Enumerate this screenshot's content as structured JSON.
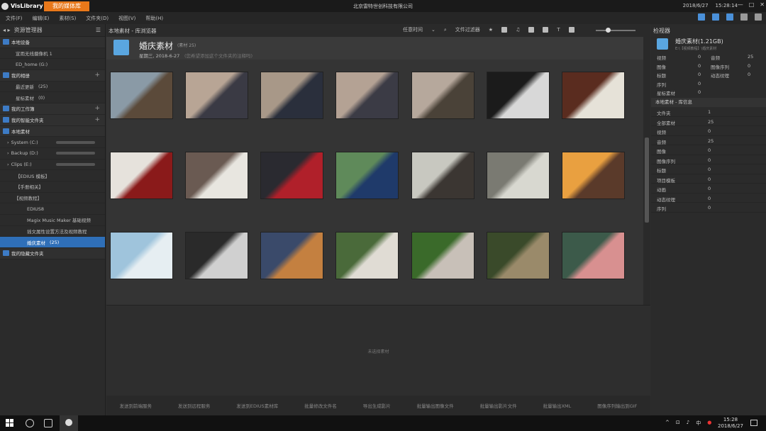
{
  "app": {
    "name": "VisLibrary",
    "active_tab": "我的媒体库",
    "company": "北京雷特世创科技有限公司",
    "date": "2018/6/27",
    "time": "15:28:14"
  },
  "menu": [
    "文件(F)",
    "编辑(E)",
    "素材(S)",
    "文件夹(D)",
    "视图(V)",
    "帮助(H)"
  ],
  "left_panel": {
    "title": "资源管理器",
    "items": [
      {
        "label": "本地设备",
        "type": "section"
      },
      {
        "label": "宣雨无线摄像机 1",
        "type": "item"
      },
      {
        "label": "ED_home (G:)",
        "type": "item"
      },
      {
        "label": "我的相册",
        "type": "section"
      },
      {
        "label": "最近更新",
        "count": "(25)",
        "type": "item"
      },
      {
        "label": "星标素材",
        "count": "(0)",
        "type": "item"
      },
      {
        "label": "我的工作簿",
        "type": "section"
      },
      {
        "label": "我的智能文件夹",
        "type": "section"
      },
      {
        "label": "本地素材",
        "type": "section"
      },
      {
        "label": "System (C:)",
        "type": "drive"
      },
      {
        "label": "Backup (D:)",
        "type": "drive"
      },
      {
        "label": "Clips (E:)",
        "type": "drive"
      },
      {
        "label": "【EDIUS 模板】",
        "type": "folder"
      },
      {
        "label": "【手册相关】",
        "type": "folder"
      },
      {
        "label": "【视频教程】",
        "type": "folder"
      },
      {
        "label": "EDIUS8",
        "type": "folder"
      },
      {
        "label": "Magix Music Maker 基础视频",
        "type": "folder"
      },
      {
        "label": "插文属性设置方法及视频教程",
        "type": "folder"
      },
      {
        "label": "婚庆素材",
        "count": "(25)",
        "type": "selected"
      },
      {
        "label": "我的隐藏文件夹",
        "type": "section"
      }
    ]
  },
  "center": {
    "breadcrumb": "本地素材 - 库浏览器",
    "sort": "任意时间",
    "filter_label": "文件过滤器",
    "album_title": "婚庆素材",
    "album_count": "(素材 25)",
    "album_date": "星期三, 2018-6-27",
    "album_hint": "(您希望添加这个文件夹的注释吗)",
    "preview_label": "未选择素材",
    "actions": [
      "发送到前端服务",
      "发送到远程服务",
      "发送到EDIUS素材库",
      "批量修改文件名",
      "导出生成影片",
      "批量输出图像文件",
      "批量输出影片文件",
      "批量输出XML",
      "图像序列输出到GIF"
    ]
  },
  "thumbs": [
    {
      "c1": "#8a9aa6",
      "c2": "#5b4a3a"
    },
    {
      "c1": "#b8a595",
      "c2": "#3a3a44"
    },
    {
      "c1": "#a89888",
      "c2": "#2a2f3c"
    },
    {
      "c1": "#b4a294",
      "c2": "#3b3b45"
    },
    {
      "c1": "#b6a89c",
      "c2": "#4a4238"
    },
    {
      "c1": "#1b1b1b",
      "c2": "#d8d8d8"
    },
    {
      "c1": "#5a2c1f",
      "c2": "#e6e2d8"
    },
    {
      "c1": "#e6e2dc",
      "c2": "#8a1a1a"
    },
    {
      "c1": "#6a5a52",
      "c2": "#e8e6e0"
    },
    {
      "c1": "#2a2a30",
      "c2": "#b0202a"
    },
    {
      "c1": "#5f8a5a",
      "c2": "#1f3a6a"
    },
    {
      "c1": "#c8c8c0",
      "c2": "#3b3632"
    },
    {
      "c1": "#7a7a72",
      "c2": "#d8d8d0"
    },
    {
      "c1": "#e9a040",
      "c2": "#5a3a2a"
    },
    {
      "c1": "#9fc4dc",
      "c2": "#e6eef2"
    },
    {
      "c1": "#2a2a2a",
      "c2": "#d0d0d0"
    },
    {
      "c1": "#3a4a6a",
      "c2": "#c48040"
    },
    {
      "c1": "#4a6a3a",
      "c2": "#e0dcd4"
    },
    {
      "c1": "#3a6a2a",
      "c2": "#c8c0b8"
    },
    {
      "c1": "#3a4a2a",
      "c2": "#9a8a6a"
    },
    {
      "c1": "#3c5a4a",
      "c2": "#d89090"
    }
  ],
  "right_panel": {
    "title": "检视器",
    "folder_name": "婚庆素材(1.21GB)",
    "folder_path": "E:\\【视频教程】\\婚庆素材",
    "stats_left": [
      [
        "视频",
        "0"
      ],
      [
        "图像",
        "0"
      ],
      [
        "标题",
        "0"
      ],
      [
        "序列",
        "0"
      ],
      [
        "星标素材",
        "0"
      ]
    ],
    "stats_right": [
      [
        "音频",
        "25"
      ],
      [
        "图像序列",
        "0"
      ],
      [
        "动态纹理",
        "0"
      ]
    ],
    "lib_title": "本地素材 - 库信息",
    "lib": [
      [
        "文件夹",
        "1"
      ],
      [
        "全部素材",
        "25"
      ],
      [
        "视频",
        "0"
      ],
      [
        "音频",
        "25"
      ],
      [
        "图像",
        "0"
      ],
      [
        "图像序列",
        "0"
      ],
      [
        "标题",
        "0"
      ],
      [
        "项目模板",
        "0"
      ],
      [
        "动画",
        "0"
      ],
      [
        "动态纹理",
        "0"
      ],
      [
        "序列",
        "0"
      ]
    ]
  },
  "taskbar": {
    "time": "15:28",
    "date": "2018/6/27",
    "ime": "中"
  }
}
